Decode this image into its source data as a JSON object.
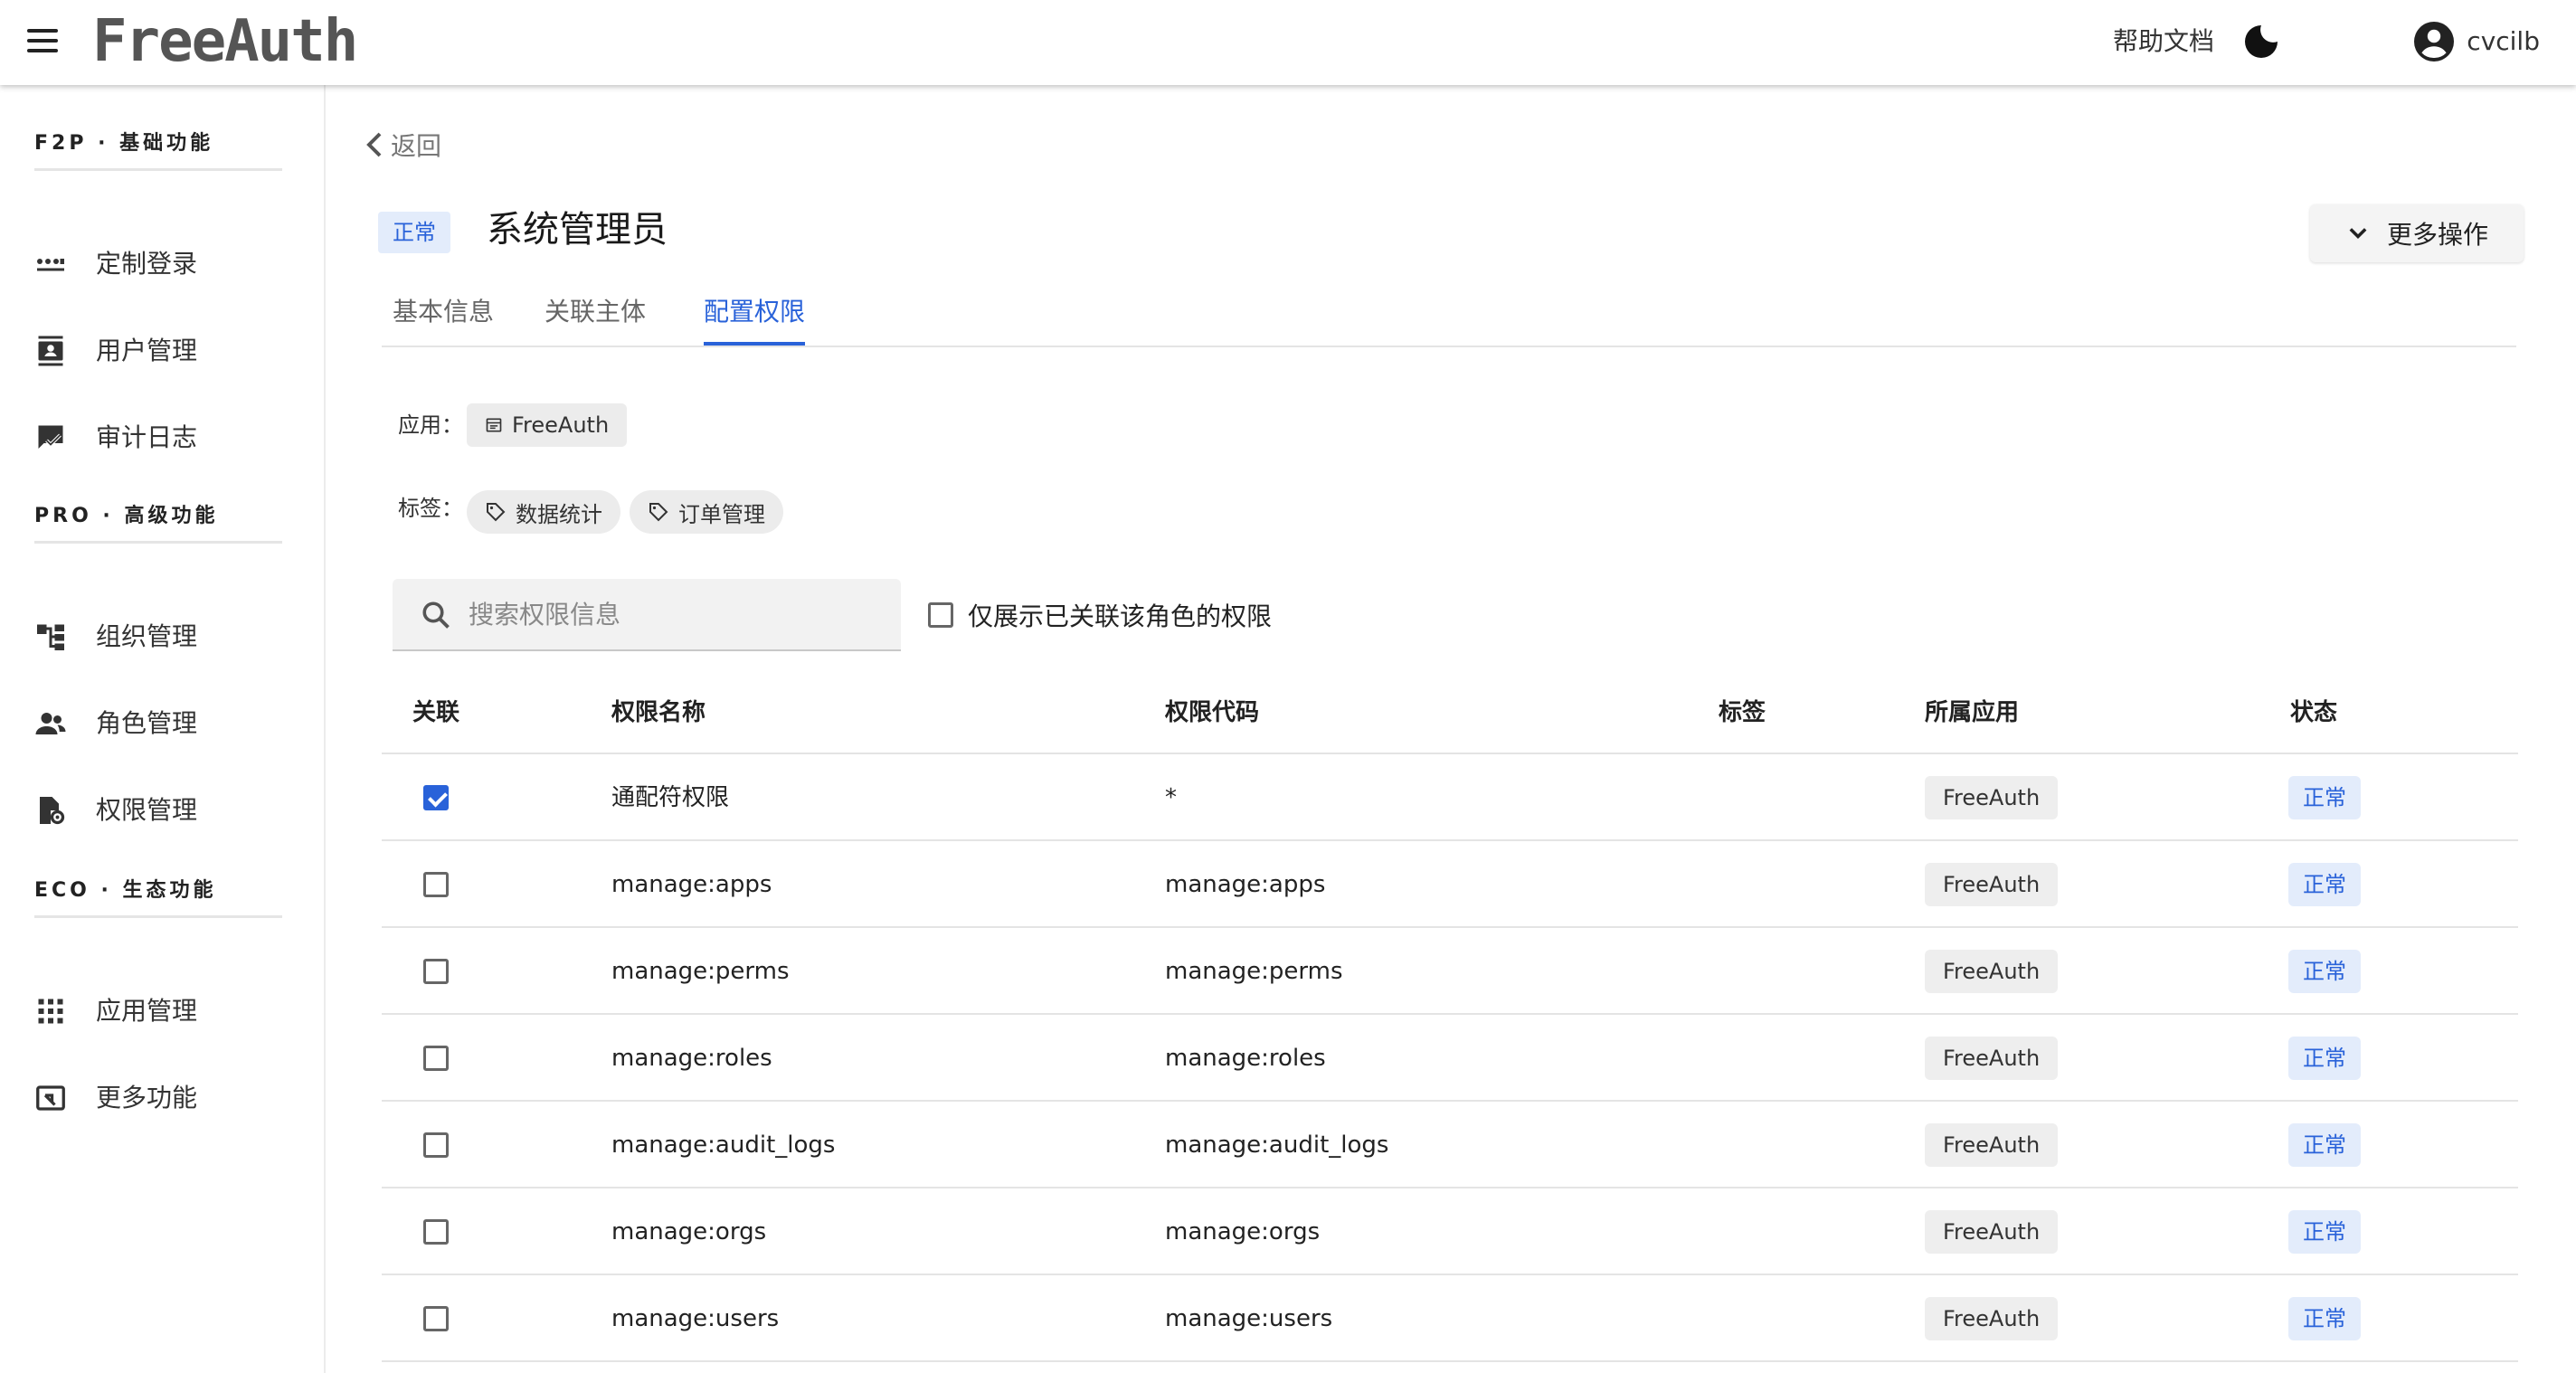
{
  "topbar": {
    "logo": "FreeAuth",
    "help_label": "帮助文档",
    "username": "cvcilb"
  },
  "sidebar": {
    "sections": [
      {
        "title": "F2P · 基础功能",
        "items": [
          {
            "label": "定制登录",
            "icon": "dots-login-icon"
          },
          {
            "label": "用户管理",
            "icon": "contact-card-icon"
          },
          {
            "label": "审计日志",
            "icon": "comment-check-icon"
          }
        ]
      },
      {
        "title": "PRO · 高级功能",
        "items": [
          {
            "label": "组织管理",
            "icon": "org-tree-icon"
          },
          {
            "label": "角色管理",
            "icon": "people-icon"
          },
          {
            "label": "权限管理",
            "icon": "permission-icon"
          }
        ]
      },
      {
        "title": "ECO · 生态功能",
        "items": [
          {
            "label": "应用管理",
            "icon": "grid-apps-icon"
          },
          {
            "label": "更多功能",
            "icon": "extension-icon"
          }
        ]
      }
    ]
  },
  "main": {
    "back_label": "返回",
    "status": "正常",
    "title": "系统管理员",
    "more_actions_label": "更多操作",
    "tabs": [
      {
        "label": "基本信息",
        "active": false
      },
      {
        "label": "关联主体",
        "active": false
      },
      {
        "label": "配置权限",
        "active": true
      }
    ],
    "app_label": "应用：",
    "app_value": "FreeAuth",
    "tags_label": "标签：",
    "tags": [
      "数据统计",
      "订单管理"
    ],
    "search": {
      "placeholder": "搜索权限信息",
      "value": ""
    },
    "filter_label": "仅展示已关联该角色的权限",
    "filter_checked": false
  },
  "table": {
    "headers": [
      "关联",
      "权限名称",
      "权限代码",
      "标签",
      "所属应用",
      "状态"
    ],
    "rows": [
      {
        "checked": true,
        "name": "通配符权限",
        "code": "*",
        "tags": "",
        "app": "FreeAuth",
        "status": "正常"
      },
      {
        "checked": false,
        "name": "manage:apps",
        "code": "manage:apps",
        "tags": "",
        "app": "FreeAuth",
        "status": "正常"
      },
      {
        "checked": false,
        "name": "manage:perms",
        "code": "manage:perms",
        "tags": "",
        "app": "FreeAuth",
        "status": "正常"
      },
      {
        "checked": false,
        "name": "manage:roles",
        "code": "manage:roles",
        "tags": "",
        "app": "FreeAuth",
        "status": "正常"
      },
      {
        "checked": false,
        "name": "manage:audit_logs",
        "code": "manage:audit_logs",
        "tags": "",
        "app": "FreeAuth",
        "status": "正常"
      },
      {
        "checked": false,
        "name": "manage:orgs",
        "code": "manage:orgs",
        "tags": "",
        "app": "FreeAuth",
        "status": "正常"
      },
      {
        "checked": false,
        "name": "manage:users",
        "code": "manage:users",
        "tags": "",
        "app": "FreeAuth",
        "status": "正常"
      }
    ]
  },
  "colors": {
    "accent": "#2962d9",
    "status_bg": "#e3ecfb",
    "chip_bg": "#eeeeee"
  }
}
